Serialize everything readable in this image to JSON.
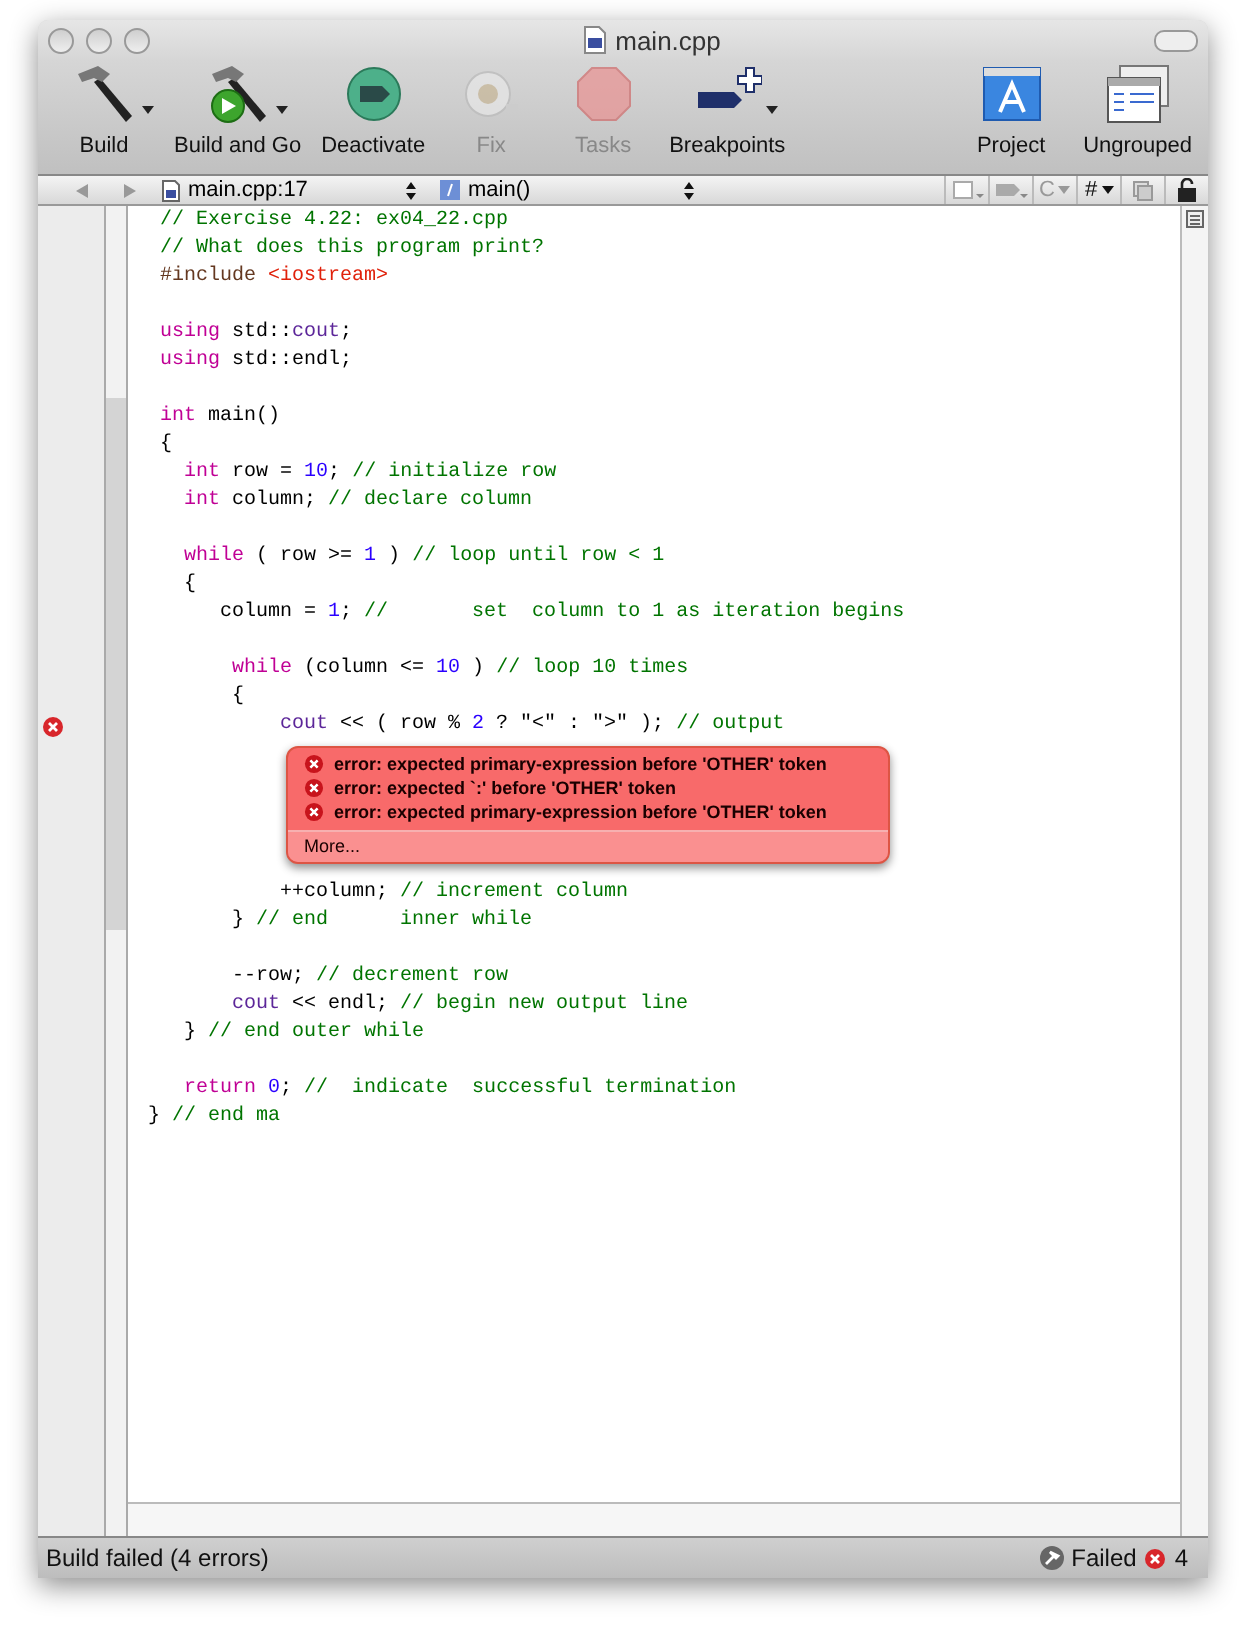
{
  "window": {
    "title": "main.cpp"
  },
  "toolbar": {
    "items": [
      {
        "kind": "build",
        "label": "Build",
        "disabled": false,
        "menu": true
      },
      {
        "kind": "build_and_go",
        "label": "Build and Go",
        "disabled": false,
        "menu": true
      },
      {
        "kind": "deactivate",
        "label": "Deactivate",
        "disabled": false,
        "menu": false
      },
      {
        "kind": "fix",
        "label": "Fix",
        "disabled": true,
        "menu": false
      },
      {
        "kind": "tasks",
        "label": "Tasks",
        "disabled": true,
        "menu": false
      },
      {
        "kind": "breakpoints",
        "label": "Breakpoints",
        "disabled": false,
        "menu": true
      }
    ],
    "right_items": [
      {
        "kind": "project",
        "label": "Project",
        "disabled": false,
        "menu": false
      },
      {
        "kind": "ungrouped",
        "label": "Ungrouped",
        "disabled": false,
        "menu": false
      }
    ]
  },
  "navigation_bar": {
    "file_popup": "main.cpp:17",
    "function_popup": "main()",
    "class_menu": "C",
    "include_menu": "#"
  },
  "editor": {
    "lines": [
      {
        "error": false,
        "tokens": [
          {
            "kind": "comment",
            "text": " // Exercise 4.22: ex04_22.cpp"
          }
        ]
      },
      {
        "error": false,
        "tokens": [
          {
            "kind": "comment",
            "text": " // What does this program print?"
          }
        ]
      },
      {
        "error": false,
        "tokens": [
          {
            "kind": "preprocessor",
            "text": " #include "
          },
          {
            "kind": "include",
            "text": "<iostream>"
          }
        ]
      },
      {
        "error": false
      },
      {
        "error": false,
        "tokens": [
          {
            "kind": "keyword",
            "text": " using"
          },
          {
            "kind": "plain",
            "text": " std::"
          },
          {
            "kind": "identifier",
            "text": "cout"
          },
          {
            "kind": "plain",
            "text": ";"
          }
        ]
      },
      {
        "error": false,
        "tokens": [
          {
            "kind": "keyword",
            "text": " using"
          },
          {
            "kind": "plain",
            "text": " std::endl;"
          }
        ]
      },
      {
        "error": false
      },
      {
        "error": false,
        "tokens": [
          {
            "kind": "keyword",
            "text": " int"
          },
          {
            "kind": "plain",
            "text": " main()"
          }
        ]
      },
      {
        "error": false,
        "tokens": [
          {
            "kind": "plain",
            "text": " {"
          }
        ]
      },
      {
        "error": false,
        "tokens": [
          {
            "kind": "keyword",
            "text": "   int"
          },
          {
            "kind": "plain",
            "text": " row = "
          },
          {
            "kind": "number",
            "text": "10"
          },
          {
            "kind": "plain",
            "text": "; "
          },
          {
            "kind": "comment",
            "text": "// initialize row"
          }
        ]
      },
      {
        "error": false,
        "tokens": [
          {
            "kind": "keyword",
            "text": "   int"
          },
          {
            "kind": "plain",
            "text": " column; "
          },
          {
            "kind": "comment",
            "text": "// declare column"
          }
        ]
      },
      {
        "error": false
      },
      {
        "error": false,
        "tokens": [
          {
            "kind": "keyword",
            "text": "   while"
          },
          {
            "kind": "plain",
            "text": " ( row >= "
          },
          {
            "kind": "number",
            "text": "1"
          },
          {
            "kind": "plain",
            "text": " ) "
          },
          {
            "kind": "comment",
            "text": "// loop until row < 1"
          }
        ]
      },
      {
        "error": false,
        "tokens": [
          {
            "kind": "plain",
            "text": "   {"
          }
        ]
      },
      {
        "error": false,
        "tokens": [
          {
            "kind": "plain",
            "text": "      column = "
          },
          {
            "kind": "number",
            "text": "1"
          },
          {
            "kind": "plain",
            "text": "; "
          },
          {
            "kind": "comment",
            "text": "//       set  column to 1 as iteration begins"
          }
        ]
      },
      {
        "error": false
      },
      {
        "error": false,
        "tokens": [
          {
            "kind": "keyword",
            "text": "       while"
          },
          {
            "kind": "plain",
            "text": " (column <= "
          },
          {
            "kind": "number",
            "text": "10"
          },
          {
            "kind": "plain",
            "text": " ) "
          },
          {
            "kind": "comment",
            "text": "// loop 10 times"
          }
        ]
      },
      {
        "error": false,
        "tokens": [
          {
            "kind": "plain",
            "text": "       {"
          }
        ]
      },
      {
        "error": true,
        "tokens": [
          {
            "kind": "identifier",
            "text": "           cout"
          },
          {
            "kind": "plain",
            "text": " << ( row % "
          },
          {
            "kind": "number",
            "text": "2"
          },
          {
            "kind": "plain",
            "text": " ? \"<\" : \">\" ); "
          },
          {
            "kind": "comment",
            "text": "// output"
          }
        ]
      },
      {
        "error": false
      },
      {
        "error": false
      },
      {
        "error": false
      },
      {
        "error": false
      },
      {
        "error": false
      },
      {
        "error": false,
        "tokens": [
          {
            "kind": "plain",
            "text": "           ++column; "
          },
          {
            "kind": "comment",
            "text": "// increment column"
          }
        ]
      },
      {
        "error": false,
        "tokens": [
          {
            "kind": "plain",
            "text": "       } "
          },
          {
            "kind": "comment",
            "text": "// end      inner while"
          }
        ]
      },
      {
        "error": false
      },
      {
        "error": false,
        "tokens": [
          {
            "kind": "plain",
            "text": "       --row; "
          },
          {
            "kind": "comment",
            "text": "// decrement row"
          }
        ]
      },
      {
        "error": false,
        "tokens": [
          {
            "kind": "identifier",
            "text": "       cout"
          },
          {
            "kind": "plain",
            "text": " << endl; "
          },
          {
            "kind": "comment",
            "text": "// begin new output line"
          }
        ]
      },
      {
        "error": false,
        "tokens": [
          {
            "kind": "plain",
            "text": "   } "
          },
          {
            "kind": "comment",
            "text": "// end outer while"
          }
        ]
      },
      {
        "error": false
      },
      {
        "error": false,
        "tokens": [
          {
            "kind": "keyword",
            "text": "   return "
          },
          {
            "kind": "number",
            "text": "0"
          },
          {
            "kind": "plain",
            "text": "; "
          },
          {
            "kind": "comment",
            "text": "//  indicate  successful termination"
          }
        ]
      },
      {
        "error": false,
        "tokens": [
          {
            "kind": "plain",
            "text": "} "
          },
          {
            "kind": "comment",
            "text": "// end ma"
          }
        ]
      }
    ]
  },
  "error_bubble": {
    "messages": [
      "error: expected primary-expression before 'OTHER' token",
      "error: expected `:' before 'OTHER' token",
      "error: expected primary-expression before 'OTHER' token"
    ],
    "more": "More..."
  },
  "status_bar": {
    "message": "Build failed (4 errors)",
    "build_status": "Failed",
    "error_count": "4"
  }
}
